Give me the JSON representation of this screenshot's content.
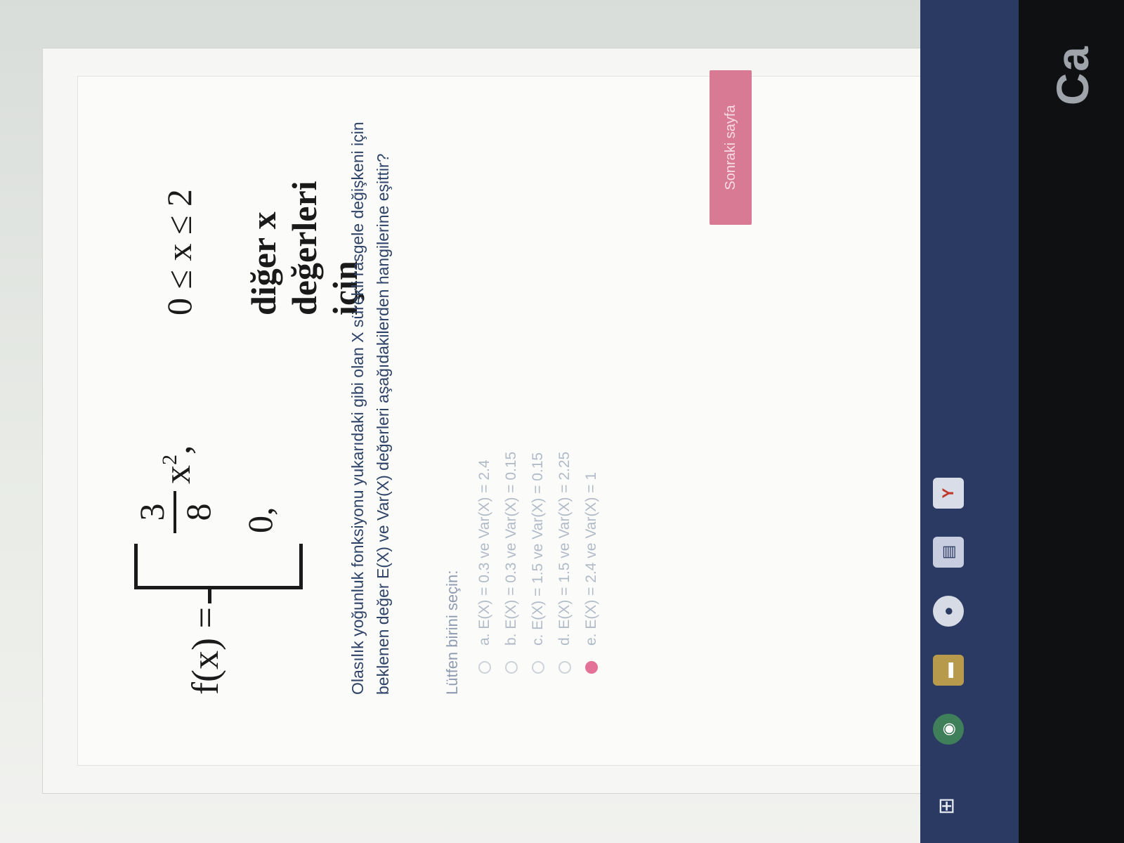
{
  "formula": {
    "lhs": "f(x) =",
    "case1": {
      "coef_num": "3",
      "coef_den": "8",
      "expr": "x",
      "exp": "2",
      "comma": ",",
      "condition": "0 ≤ x ≤ 2"
    },
    "case2": {
      "value": "0,",
      "condition": "diğer x değerleri için"
    }
  },
  "question": {
    "text": "Olasılık yoğunluk fonksiyonu yukarıdaki gibi olan X sürekli rasgele değişkeni için beklenen değer E(X) ve Var(X) değerleri aşağıdakilerden hangilerine eşittir?"
  },
  "prompt": "Lütfen birini seçin:",
  "options": [
    {
      "label": "a. E(X) = 0.3 ve Var(X) = 2.4"
    },
    {
      "label": "b. E(X) = 0.3 ve Var(X) = 0.15"
    },
    {
      "label": "c. E(X) = 1.5 ve Var(X) = 0.15"
    },
    {
      "label": "d. E(X) = 1.5 ve Var(X) = 2.25"
    },
    {
      "label": "e. E(X) = 2.4 ve Var(X) = 1"
    }
  ],
  "selected_option": 4,
  "submit_label": "Sonraki sayfa",
  "taskbar": {
    "start_glyph": "⊞",
    "icons": [
      "chrome-icon",
      "folder-icon",
      "mail-icon",
      "word-icon",
      "yandex-icon"
    ]
  },
  "brand_text": "Ca",
  "colors": {
    "question_text": "#2f4468",
    "accent": "#e05a88",
    "taskbar": "#2b3a62"
  }
}
